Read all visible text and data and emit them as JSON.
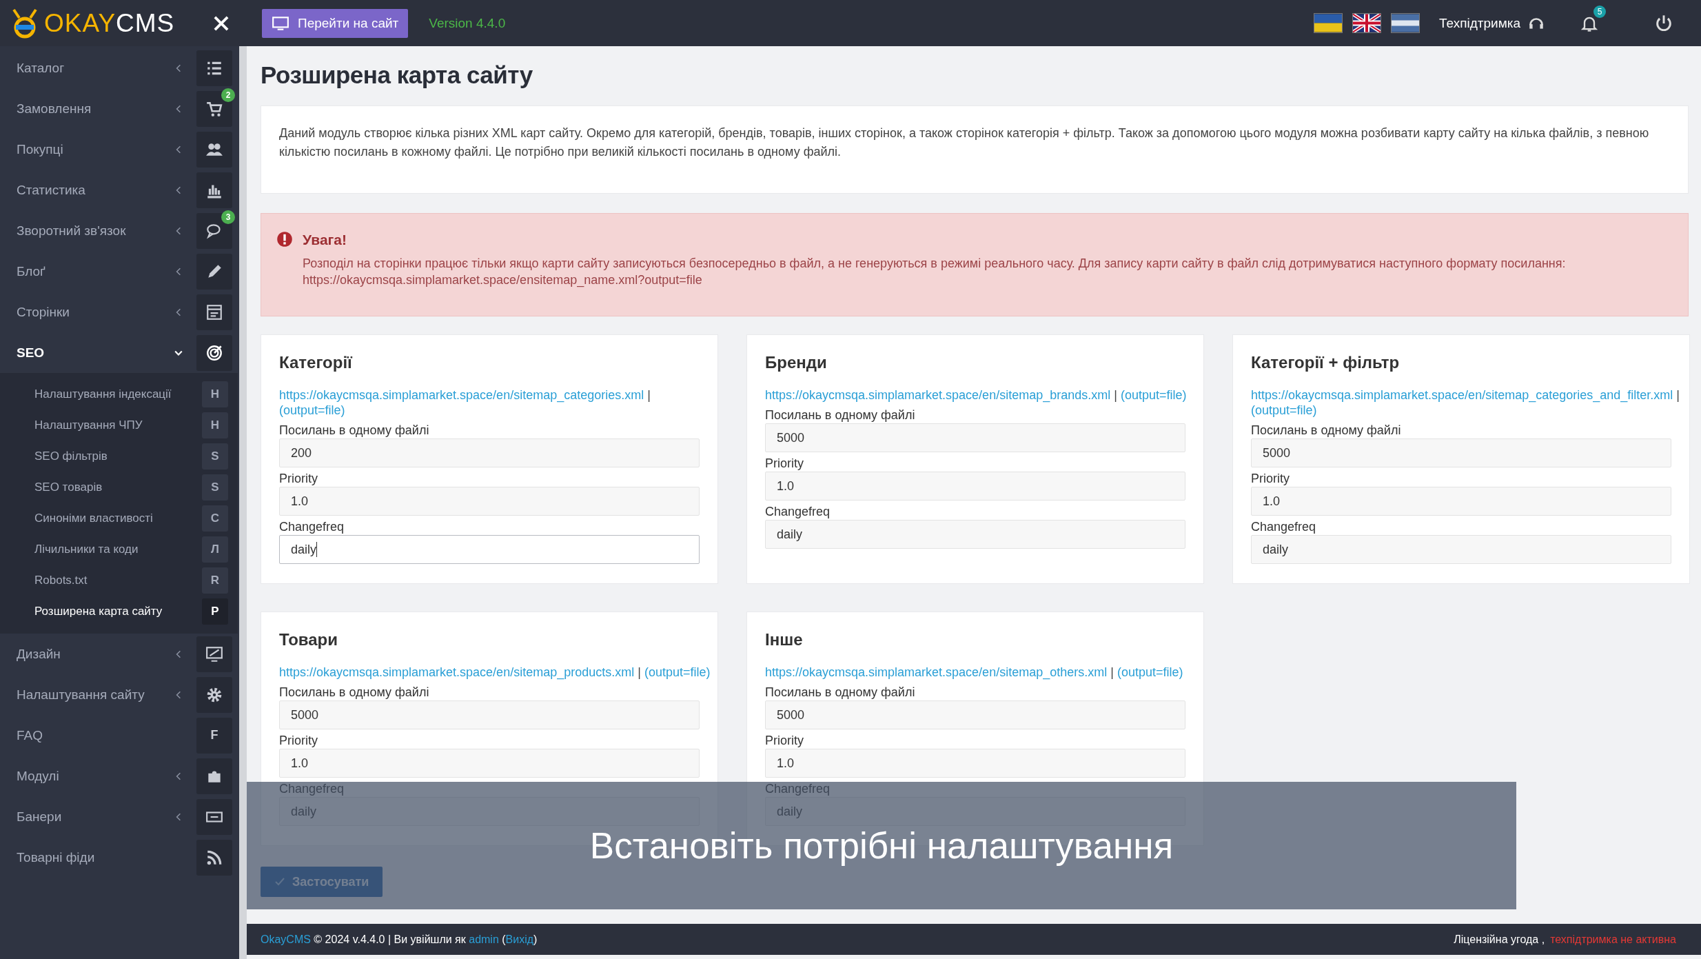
{
  "header": {
    "logo": {
      "part_1": "OKAY",
      "part_2": "CMS"
    },
    "site_button": "Перейти на сайт",
    "version": "Version 4.4.0",
    "support": "Техпідтримка",
    "notifications_badge": "5"
  },
  "sidebar": {
    "items": [
      {
        "label": "Каталог",
        "expanded": false
      },
      {
        "label": "Замовлення",
        "expanded": false,
        "badge": "2"
      },
      {
        "label": "Покупці",
        "expanded": false
      },
      {
        "label": "Статистика",
        "expanded": false
      },
      {
        "label": "Зворотний зв'язок",
        "expanded": false,
        "badge": "3"
      },
      {
        "label": "Блоґ",
        "expanded": false
      },
      {
        "label": "Сторінки",
        "expanded": false
      },
      {
        "label": "SEO",
        "expanded": true,
        "children": [
          {
            "label": "Налаштування індексації",
            "letter": "H",
            "selected": false
          },
          {
            "label": "Налаштування ЧПУ",
            "letter": "H",
            "selected": false
          },
          {
            "label": "SEO фільтрів",
            "letter": "S",
            "selected": false
          },
          {
            "label": "SEO товарів",
            "letter": "S",
            "selected": false
          },
          {
            "label": "Синоніми властивості",
            "letter": "C",
            "selected": false
          },
          {
            "label": "Лічильники та коди",
            "letter": "Л",
            "selected": false
          },
          {
            "label": "Robots.txt",
            "letter": "R",
            "selected": false
          },
          {
            "label": "Розширена карта сайту",
            "letter": "P",
            "selected": true
          }
        ]
      },
      {
        "label": "Дизайн",
        "expanded": false
      },
      {
        "label": "Налаштування сайту",
        "expanded": false
      },
      {
        "label": "FAQ",
        "letter": "F"
      },
      {
        "label": "Модулі",
        "expanded": false
      },
      {
        "label": "Банери",
        "expanded": false
      },
      {
        "label": "Товарні фіди"
      }
    ]
  },
  "page": {
    "title": "Розширена карта сайту",
    "description": "Даний модуль створює кілька різних XML карт сайту. Окремо для категорій, брендів, товарів, інших сторінок, а також сторінок категорія + фільтр. Також за допомогою цього модуля можна розбивати карту сайту на кілька файлів, з певною кількістю посилань в кожному файлі. Це потрібно при великій кількості посилань в одному файлі.",
    "alert": {
      "title": "Увага!",
      "text": "Розподіл на сторінки працює тільки якщо карти сайту записуються безпосередньо в файл, а не генеруються в режимі реального часу. Для запису карти сайту в файл слід дотримуватися наступного формату посилання: https://okaycmsqa.simplamarket.space/ensitemap_name.xml?output=file"
    },
    "cards": [
      {
        "title": "Категорії",
        "url": "https://okaycmsqa.simplamarket.space/en/sitemap_categories.xml",
        "separator": "|",
        "output_link": "(output=file)",
        "fields": [
          {
            "label": "Посилань в одному файлі",
            "value": "200",
            "focused": false
          },
          {
            "label": "Priority",
            "value": "1.0",
            "focused": false
          },
          {
            "label": "Changefreq",
            "value": "daily",
            "focused": true
          }
        ]
      },
      {
        "title": "Бренди",
        "url": "https://okaycmsqa.simplamarket.space/en/sitemap_brands.xml",
        "separator": "|",
        "output_link": "(output=file)",
        "fields": [
          {
            "label": "Посилань в одному файлі",
            "value": "5000",
            "focused": false
          },
          {
            "label": "Priority",
            "value": "1.0",
            "focused": false
          },
          {
            "label": "Changefreq",
            "value": "daily",
            "focused": false
          }
        ]
      },
      {
        "title": "Категорії + фільтр",
        "url": "https://okaycmsqa.simplamarket.space/en/sitemap_categories_and_filter.xml",
        "separator": "|",
        "output_link": "(output=file)",
        "fields": [
          {
            "label": "Посилань в одному файлі",
            "value": "5000",
            "focused": false
          },
          {
            "label": "Priority",
            "value": "1.0",
            "focused": false
          },
          {
            "label": "Changefreq",
            "value": "daily",
            "focused": false
          }
        ]
      },
      {
        "title": "Товари",
        "url": "https://okaycmsqa.simplamarket.space/en/sitemap_products.xml",
        "separator": "|",
        "output_link": "(output=file)",
        "fields": [
          {
            "label": "Посилань в одному файлі",
            "value": "5000",
            "focused": false
          },
          {
            "label": "Priority",
            "value": "1.0",
            "focused": false
          },
          {
            "label": "Changefreq",
            "value": "daily",
            "focused": false
          }
        ]
      },
      {
        "title": "Інше",
        "url": "https://okaycmsqa.simplamarket.space/en/sitemap_others.xml",
        "separator": "|",
        "output_link": "(output=file)",
        "fields": [
          {
            "label": "Посилань в одному файлі",
            "value": "5000",
            "focused": false
          },
          {
            "label": "Priority",
            "value": "1.0",
            "focused": false
          },
          {
            "label": "Changefreq",
            "value": "daily",
            "focused": false
          }
        ]
      }
    ],
    "apply_button": "Застосувати"
  },
  "footer": {
    "brand_link": "OkayCMS",
    "text": "© 2024 v.4.4.0 | Ви увійшли як",
    "user_link": "admin",
    "open_paren": "(",
    "logout_link": "Вихід",
    "close_paren": ")",
    "license": "Ліцензійна угода ,",
    "support_status": "техпідтримка не активна"
  },
  "caption": "Встановіть потрібні налаштування"
}
